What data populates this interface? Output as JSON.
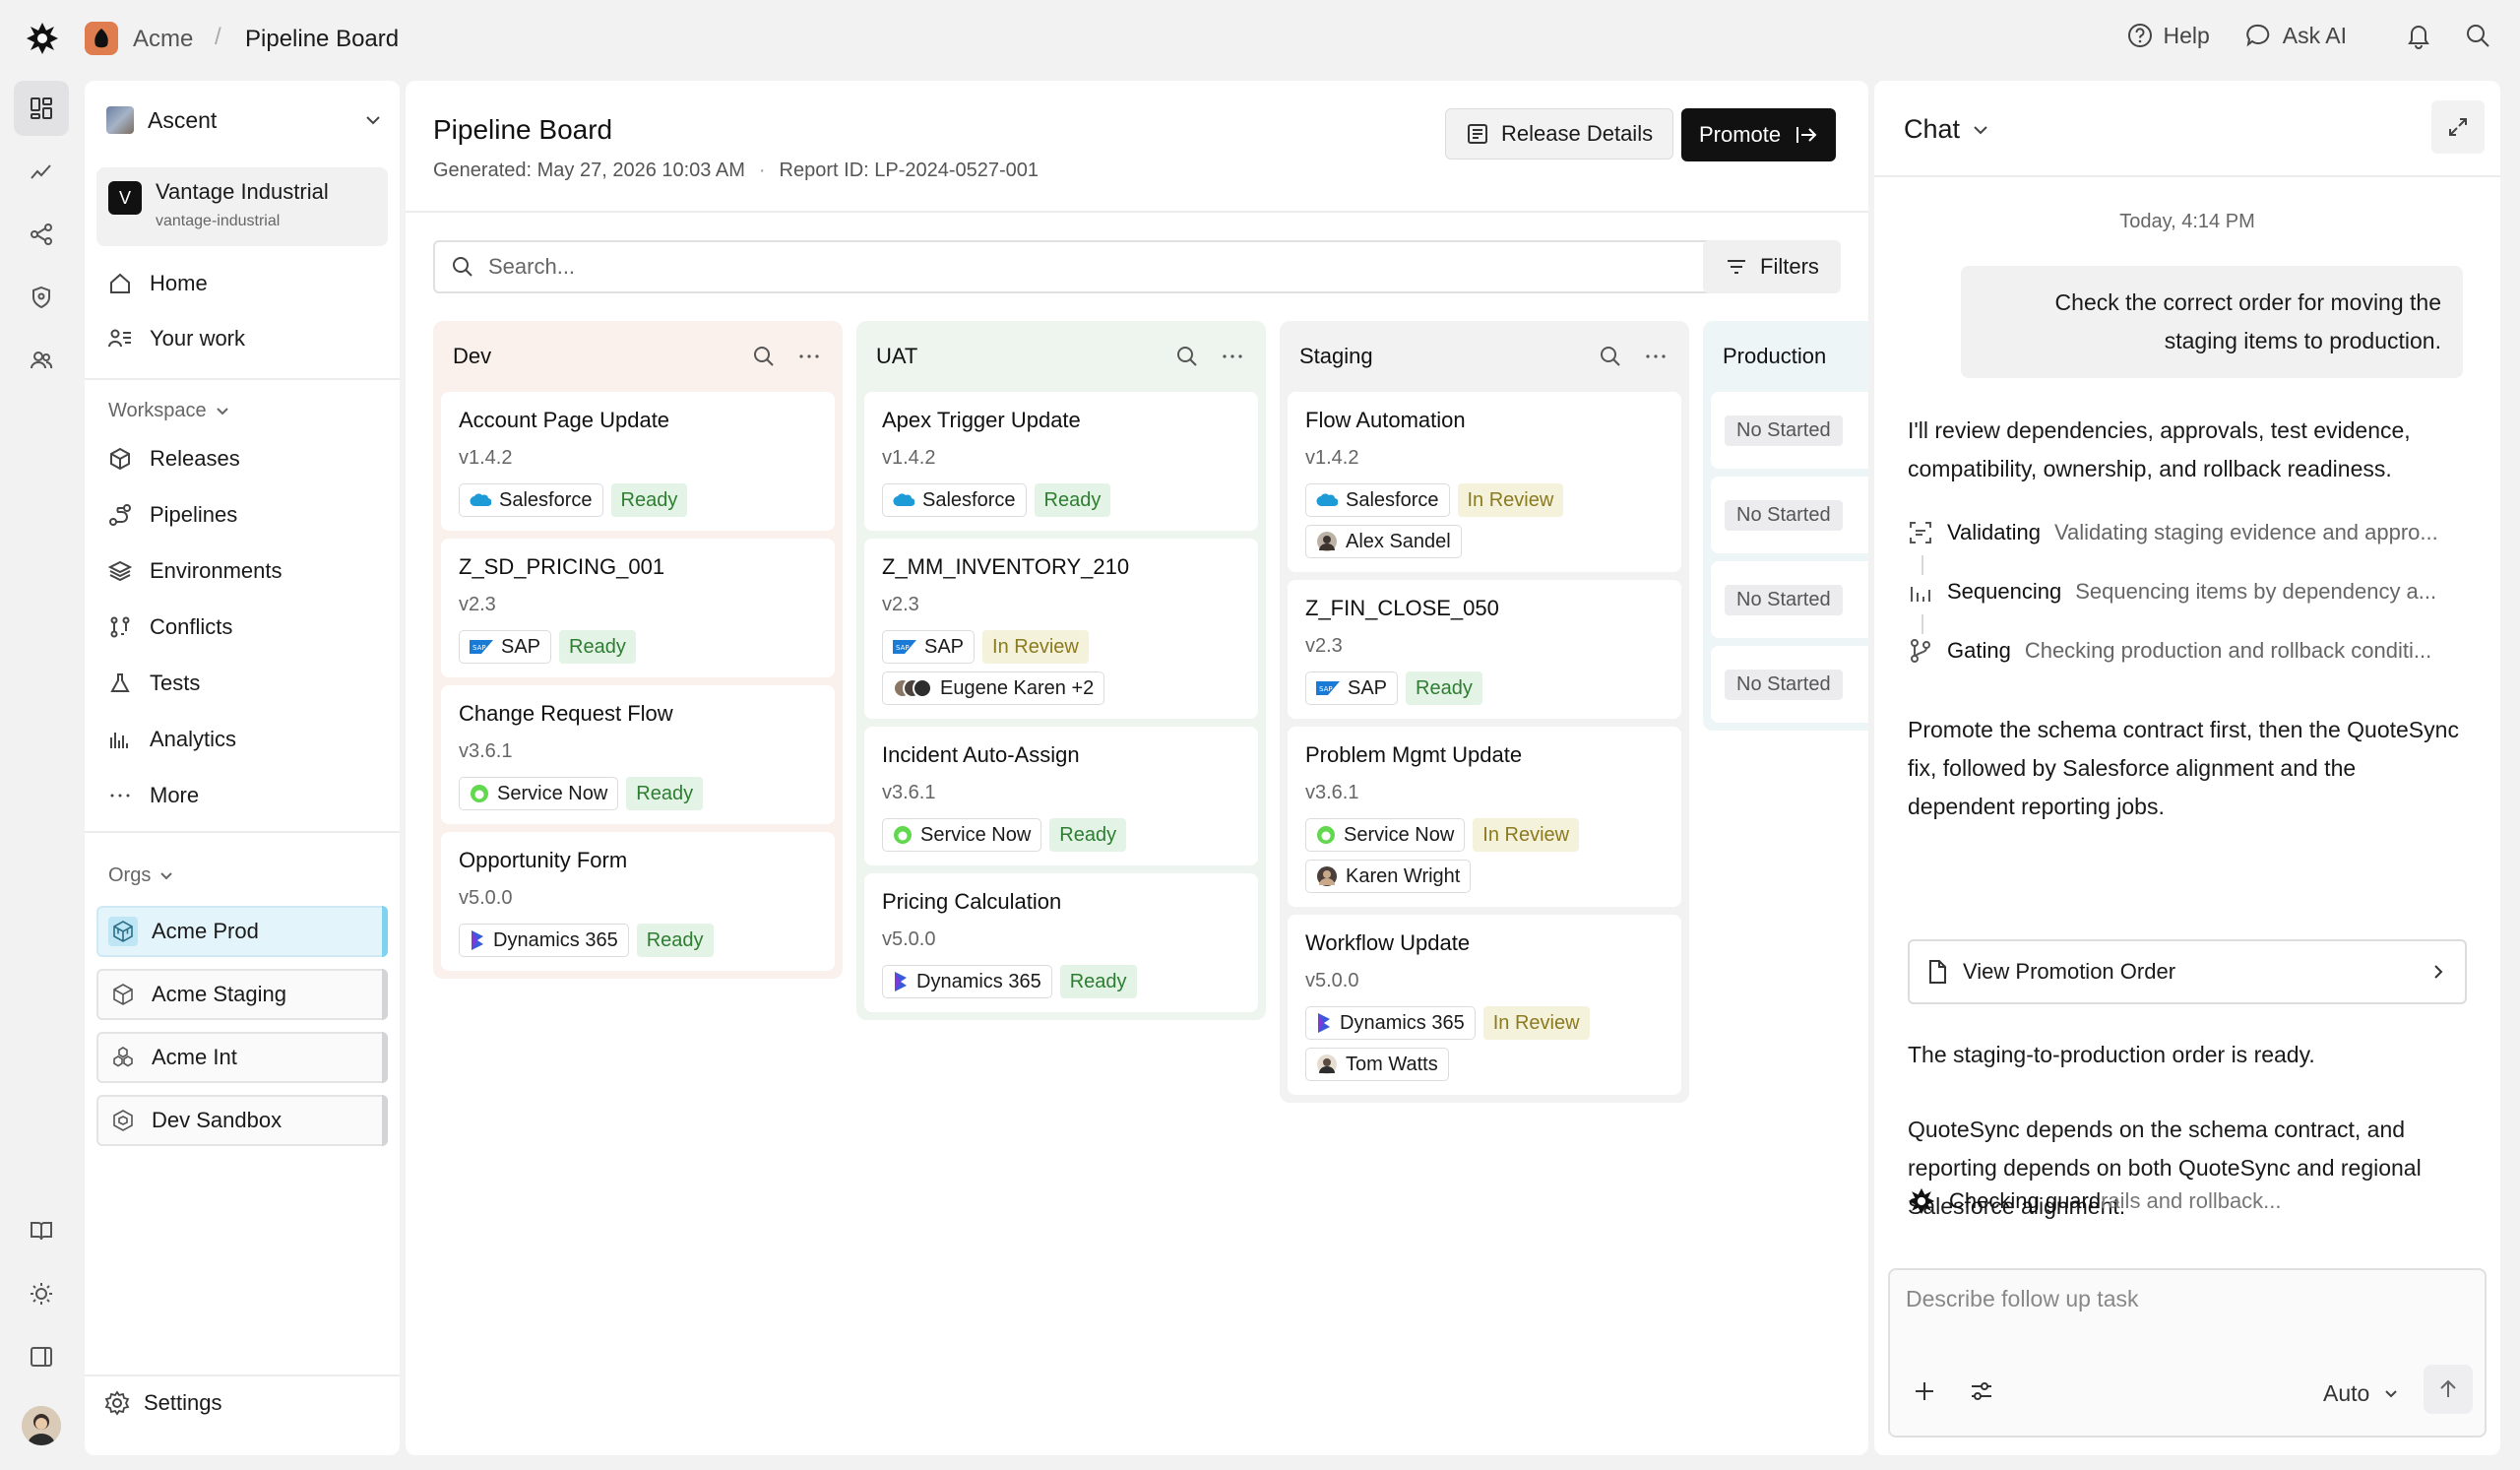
{
  "breadcrumb": {
    "org": "Acme",
    "separator": "/",
    "page": "Pipeline Board"
  },
  "top_actions": {
    "help": "Help",
    "ask_ai": "Ask AI"
  },
  "sidebar": {
    "workspace": "Ascent",
    "org_card": {
      "badge": "V",
      "name": "Vantage Industrial",
      "slug": "vantage-industrial"
    },
    "primary": [
      {
        "label": "Home"
      },
      {
        "label": "Your work"
      }
    ],
    "workspace_section": "Workspace",
    "workspace_items": [
      {
        "label": "Releases"
      },
      {
        "label": "Pipelines"
      },
      {
        "label": "Environments"
      },
      {
        "label": "Conflicts"
      },
      {
        "label": "Tests"
      },
      {
        "label": "Analytics"
      },
      {
        "label": "More"
      }
    ],
    "orgs_section": "Orgs",
    "orgs": [
      {
        "label": "Acme Prod"
      },
      {
        "label": "Acme Staging"
      },
      {
        "label": "Acme Int"
      },
      {
        "label": "Dev Sandbox"
      }
    ],
    "settings": "Settings"
  },
  "main": {
    "title": "Pipeline Board",
    "generated": "Generated: May 27, 2026 10:03 AM",
    "meta_sep": "·",
    "report_id": "Report ID: LP-2024-0527-001",
    "release_details": "Release Details",
    "promote": "Promote",
    "search_placeholder": "Search...",
    "filters": "Filters"
  },
  "columns": [
    {
      "name": "Dev",
      "cards": [
        {
          "title": "Account Page Update",
          "version": "v1.4.2",
          "platform": "Salesforce",
          "status": "Ready"
        },
        {
          "title": "Z_SD_PRICING_001",
          "version": "v2.3",
          "platform": "SAP",
          "status": "Ready"
        },
        {
          "title": "Change Request Flow",
          "version": "v3.6.1",
          "platform": "Service Now",
          "status": "Ready"
        },
        {
          "title": "Opportunity Form",
          "version": "v5.0.0",
          "platform": "Dynamics 365",
          "status": "Ready"
        }
      ]
    },
    {
      "name": "UAT",
      "cards": [
        {
          "title": "Apex Trigger Update",
          "version": "v1.4.2",
          "platform": "Salesforce",
          "status": "Ready"
        },
        {
          "title": "Z_MM_INVENTORY_210",
          "version": "v2.3",
          "platform": "SAP",
          "status": "In Review",
          "assignee": "Eugene Karen +2"
        },
        {
          "title": "Incident Auto-Assign",
          "version": "v3.6.1",
          "platform": "Service Now",
          "status": "Ready"
        },
        {
          "title": "Pricing Calculation",
          "version": "v5.0.0",
          "platform": "Dynamics 365",
          "status": "Ready"
        }
      ]
    },
    {
      "name": "Staging",
      "cards": [
        {
          "title": "Flow Automation",
          "version": "v1.4.2",
          "platform": "Salesforce",
          "status": "In Review",
          "assignee": "Alex Sandel"
        },
        {
          "title": "Z_FIN_CLOSE_050",
          "version": "v2.3",
          "platform": "SAP",
          "status": "Ready"
        },
        {
          "title": "Problem Mgmt Update",
          "version": "v3.6.1",
          "platform": "Service Now",
          "status": "In Review",
          "assignee": "Karen Wright"
        },
        {
          "title": "Workflow Update",
          "version": "v5.0.0",
          "platform": "Dynamics 365",
          "status": "In Review",
          "assignee": "Tom Watts"
        }
      ]
    },
    {
      "name": "Production",
      "cards": [
        {
          "status": "No Started"
        },
        {
          "status": "No Started"
        },
        {
          "status": "No Started"
        },
        {
          "status": "No Started"
        }
      ]
    }
  ],
  "chat": {
    "title": "Chat",
    "time": "Today, 4:14 PM",
    "user_message": "Check the correct order for moving the staging items to production.",
    "intro": "I'll review dependencies, approvals, test evidence, compatibility, ownership, and rollback readiness.",
    "steps": [
      {
        "label": "Validating",
        "desc": "Validating staging evidence and appro..."
      },
      {
        "label": "Sequencing",
        "desc": "Sequencing items by dependency a..."
      },
      {
        "label": "Gating",
        "desc": "Checking production and rollback conditi..."
      }
    ],
    "answer": "Promote the schema contract first, then the QuoteSync fix, followed by Salesforce alignment and the dependent reporting jobs.",
    "view_order": "View Promotion Order",
    "ready": "The staging-to-production order is ready.",
    "dependency": "QuoteSync depends on the schema contract, and reporting depends on both QuoteSync and regional Salesforce alignment.",
    "guard_a": "Checking guard",
    "guard_b": "rails and rollback...",
    "composer_placeholder": "Describe follow up task",
    "model": "Auto"
  },
  "colors": {
    "dev_col": "#fbf1ec",
    "uat_col": "#eef5ee",
    "staging_col": "#f2f2f3",
    "prod_col": "#eef5f7",
    "ready": "#2e7d32",
    "in_review": "#8a7a20",
    "active_org": "#7fd3ef"
  }
}
